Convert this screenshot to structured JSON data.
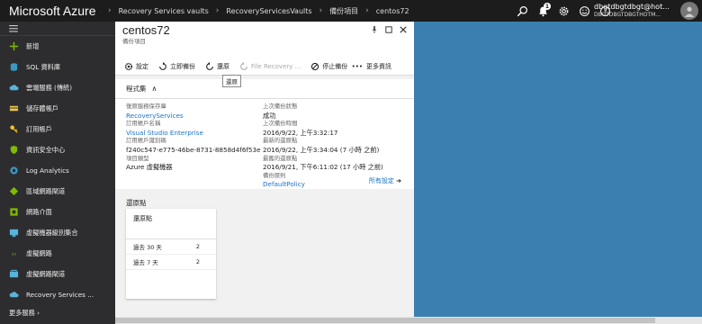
{
  "topbar": {
    "brand": "Microsoft Azure",
    "breadcrumbs": [
      "Recovery Services vaults",
      "RecoveryServicesVaults",
      "備份項目",
      "centos72"
    ],
    "notification_count": "1",
    "user_name": "dbgtdbgtdbgt@hot...",
    "user_directory": "DBGTDBGTDBGTHOTM..."
  },
  "sidebar": {
    "items": [
      {
        "label": "新增",
        "icon": "plus-icon",
        "color": "#7fba00"
      },
      {
        "label": "SQL 資料庫",
        "icon": "sql-database-icon",
        "color": "#3999c6"
      },
      {
        "label": "雲端服務 (傳統)",
        "icon": "cloud-service-icon",
        "color": "#59b4d9"
      },
      {
        "label": "儲存體帳戶",
        "icon": "storage-account-icon",
        "color": "#e8c547"
      },
      {
        "label": "訂用帳戶",
        "icon": "key-icon",
        "color": "#f5c518"
      },
      {
        "label": "資訊安全中心",
        "icon": "shield-icon",
        "color": "#7fba00"
      },
      {
        "label": "Log Analytics",
        "icon": "log-analytics-icon",
        "color": "#3999c6"
      },
      {
        "label": "區域網路閘道",
        "icon": "local-gateway-icon",
        "color": "#7fba00"
      },
      {
        "label": "網路介面",
        "icon": "network-interface-icon",
        "color": "#7fba00"
      },
      {
        "label": "虛擬機器級別集合",
        "icon": "vm-scale-set-icon",
        "color": "#59b4d9"
      },
      {
        "label": "虛擬網路",
        "icon": "virtual-network-icon",
        "color": "#7fba00"
      },
      {
        "label": "虛擬網路閘道",
        "icon": "vnet-gateway-icon",
        "color": "#59b4d9"
      },
      {
        "label": "Recovery Services ...",
        "icon": "recovery-vault-icon",
        "color": "#59b4d9"
      }
    ],
    "more_services": "更多服務"
  },
  "blade": {
    "title": "centos72",
    "subtitle": "備份項目",
    "commands": {
      "settings": "設定",
      "backup_now": "立即備份",
      "restore": "還原",
      "file_recovery": "File Recovery ...",
      "stop_backup": "停止備份",
      "more_info": "更多資訊"
    },
    "tooltip": "還原",
    "essentials": {
      "header": "程式集",
      "left": [
        {
          "label": "復原服務保存庫",
          "value": "RecoveryServices",
          "link": true
        },
        {
          "label": "訂用帳戶名稱",
          "value": "Visual Studio Enterprise",
          "link": true
        },
        {
          "label": "訂用帳戶識別碼",
          "value": "f240c547-e775-46be-8731-8858d4f6f53e",
          "link": false
        },
        {
          "label": "項目類型",
          "value": "Azure 虛擬機器",
          "link": false
        }
      ],
      "right": [
        {
          "label": "上次備份狀態",
          "value": "成功",
          "link": false
        },
        {
          "label": "上次備份時間",
          "value": "2016/9/22, 上午3:32:17",
          "link": false
        },
        {
          "label": "最新的還原點",
          "value": "2016/9/22, 上午3:34:04 (7 小時 之前)",
          "link": false
        },
        {
          "label": "最舊的還原點",
          "value": "2016/9/21, 下午6:11:02 (17 小時 之前)",
          "link": false
        },
        {
          "label": "備份原則",
          "value": "DefaultPolicy",
          "link": true
        }
      ],
      "all_settings": "所有設定"
    },
    "restore_points": {
      "section_title": "還原點",
      "card_title": "還原點",
      "rows": [
        {
          "label": "過去 30 天",
          "count": "2"
        },
        {
          "label": "過去 7 天",
          "count": "2"
        }
      ]
    }
  }
}
